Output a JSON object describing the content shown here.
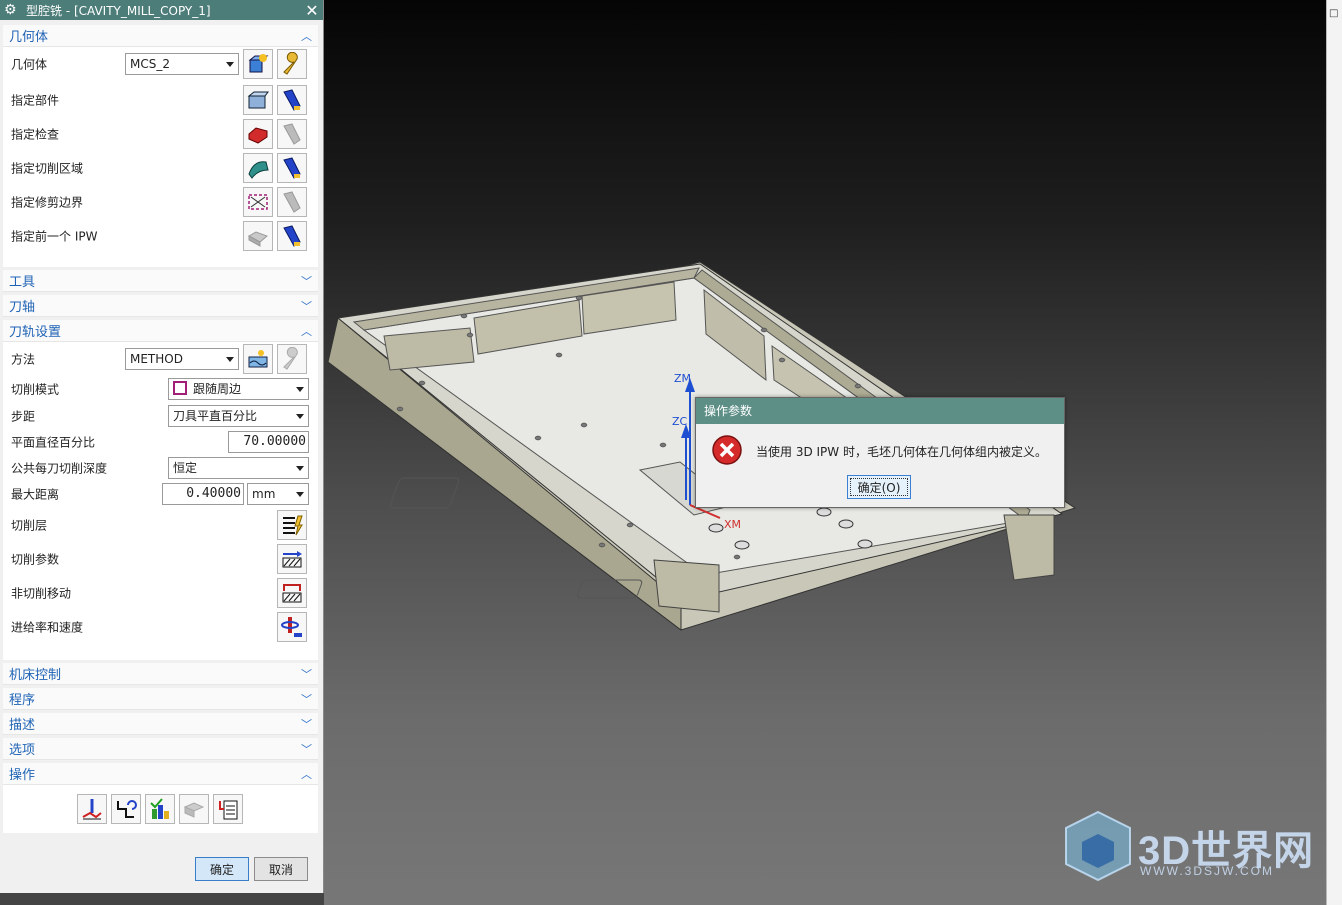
{
  "dialog": {
    "title": "型腔铣 - [CAVITY_MILL_COPY_1]",
    "icons": {
      "settings": "gear-icon",
      "close": "close-icon"
    }
  },
  "geometry": {
    "header": "几何体",
    "rows": [
      {
        "label": "几何体",
        "value": "MCS_2"
      },
      {
        "label": "指定部件"
      },
      {
        "label": "指定检查"
      },
      {
        "label": "指定切削区域"
      },
      {
        "label": "指定修剪边界"
      },
      {
        "label": "指定前一个 IPW"
      }
    ]
  },
  "collapsed_1": {
    "tools": "工具",
    "axis": "刀轴"
  },
  "path": {
    "header": "刀轨设置",
    "method_label": "方法",
    "method_value": "METHOD",
    "cut_mode_label": "切削模式",
    "cut_mode_value": "跟随周边",
    "step_label": "步距",
    "step_value": "刀具平直百分比",
    "flat_pct_label": "平面直径百分比",
    "flat_pct_value": "70.00000",
    "depth_label": "公共每刀切削深度",
    "depth_value": "恒定",
    "maxdist_label": "最大距离",
    "maxdist_value": "0.40000",
    "maxdist_unit": "mm",
    "levels_label": "切削层",
    "params_label": "切削参数",
    "noncut_label": "非切削移动",
    "feeds_label": "进给率和速度"
  },
  "collapsed_2": {
    "machine": "机床控制",
    "program": "程序",
    "desc": "描述",
    "options": "选项"
  },
  "ops": {
    "header": "操作"
  },
  "footer": {
    "ok": "确定",
    "cancel": "取消"
  },
  "message": {
    "title": "操作参数",
    "text": "当使用 3D IPW 时，毛坯几何体在几何体组内被定义。",
    "ok": "确定(O)",
    "icon": "error-icon"
  },
  "viewport": {
    "zm": "ZM",
    "zc": "ZC",
    "xm": "XM"
  },
  "watermark": {
    "brand": "3D世界网",
    "url": "WWW.3DSJW.COM"
  },
  "colors": {
    "accent": "#1f63b5",
    "title_bar": "#4c7d79",
    "msg_title": "#5d8f87"
  }
}
